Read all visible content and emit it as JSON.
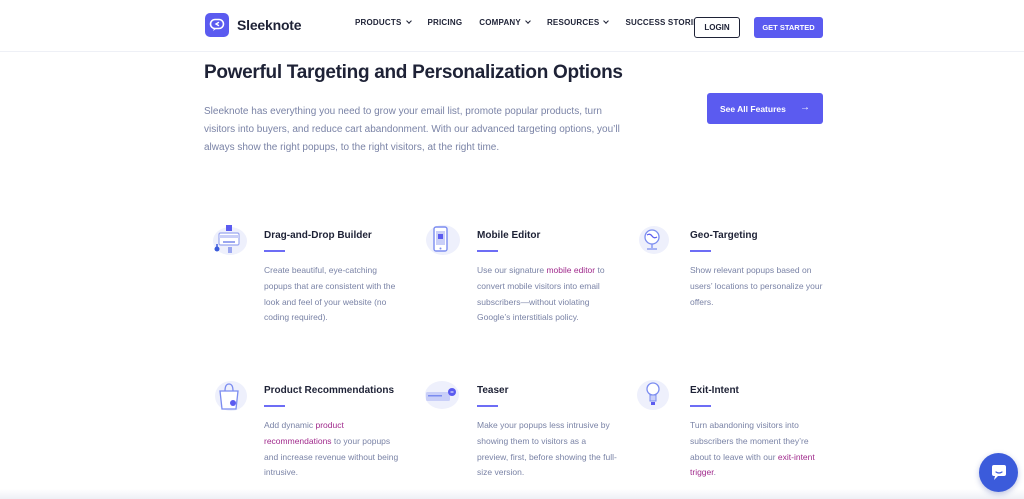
{
  "header": {
    "brand": "Sleeknote",
    "nav": [
      {
        "label": "PRODUCTS",
        "has_dropdown": true
      },
      {
        "label": "PRICING",
        "has_dropdown": false
      },
      {
        "label": "COMPANY",
        "has_dropdown": true
      },
      {
        "label": "RESOURCES",
        "has_dropdown": true
      },
      {
        "label": "SUCCESS STORIES",
        "has_dropdown": false
      }
    ],
    "login_label": "LOGIN",
    "cta_label": "GET STARTED"
  },
  "hero": {
    "title": "Powerful Targeting and Personalization Options",
    "intro": "Sleeknote has everything you need to grow your email list, promote popular products, turn visitors into buyers, and reduce cart abandonment. With our advanced targeting options, you’ll always show the right popups, to the right visitors, at the right time.",
    "features_button": "See All Features",
    "features_button_arrow": "→"
  },
  "features": [
    {
      "title": "Drag-and-Drop Builder",
      "icon": "drag-drop-builder-icon",
      "desc_before": "Create beautiful, eye-catching popups that are consistent with the look and feel of your website (no coding required).",
      "link": "",
      "desc_after": ""
    },
    {
      "title": "Mobile Editor",
      "icon": "mobile-phone-icon",
      "desc_before": "Use our signature ",
      "link": "mobile editor",
      "desc_after": " to convert mobile visitors into email subscribers—without violating Google’s interstitials policy."
    },
    {
      "title": "Geo-Targeting",
      "icon": "globe-icon",
      "desc_before": "Show relevant popups based on users’ locations to personalize your offers.",
      "link": "",
      "desc_after": ""
    },
    {
      "title": "Product Recommendations",
      "icon": "shopping-bag-icon",
      "desc_before": "Add dynamic ",
      "link": "product recommendations",
      "desc_after": " to your popups and increase revenue without being intrusive."
    },
    {
      "title": "Teaser",
      "icon": "teaser-icon",
      "desc_before": "Make your popups less intrusive by showing them to visitors as a preview, first, before showing the full-size version.",
      "link": "",
      "desc_after": ""
    },
    {
      "title": "Exit-Intent",
      "icon": "lightbulb-icon",
      "desc_before": "Turn abandoning visitors into subscribers the moment they’re about to leave with our ",
      "link": "exit-intent trigger",
      "desc_after": "."
    }
  ],
  "colors": {
    "accent": "#5b5bf0",
    "heading": "#1e2236",
    "body_text": "#7a83a6",
    "link": "#a02a8c",
    "chat": "#3b5bdb"
  },
  "chat": {
    "icon": "chat-bubble-icon"
  }
}
